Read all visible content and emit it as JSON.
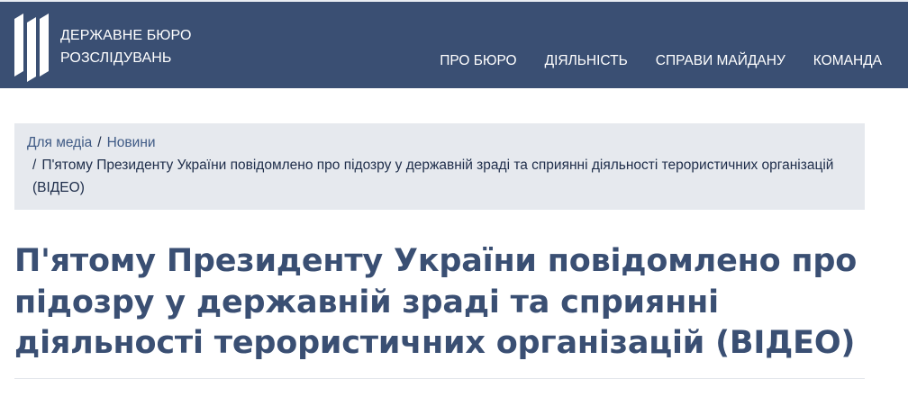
{
  "header": {
    "brand_line1": "ДЕРЖАВНЕ БЮРО",
    "brand_line2": "РОЗСЛІДУВАНЬ",
    "nav": [
      {
        "label": "ПРО БЮРО"
      },
      {
        "label": "ДІЯЛЬНІСТЬ"
      },
      {
        "label": "СПРАВИ МАЙДАНУ"
      },
      {
        "label": "КОМАНДА"
      }
    ]
  },
  "breadcrumb": {
    "items": [
      {
        "label": "Для медіа"
      },
      {
        "label": "Новини"
      }
    ],
    "separator": "/",
    "current": "П'ятому Президенту України повідомлено про підозру у державній зраді та сприянні діяльності терористичних організацій (ВІДЕО)"
  },
  "article": {
    "title": "П'ятому Президенту України повідомлено про підозру у державній зраді та сприянні діяльності терористичних організацій (ВІДЕО)"
  },
  "colors": {
    "header_bg": "#3a4f73",
    "breadcrumb_bg": "#e6e9ee",
    "title": "#3a4f73",
    "link": "#3f5a85"
  }
}
